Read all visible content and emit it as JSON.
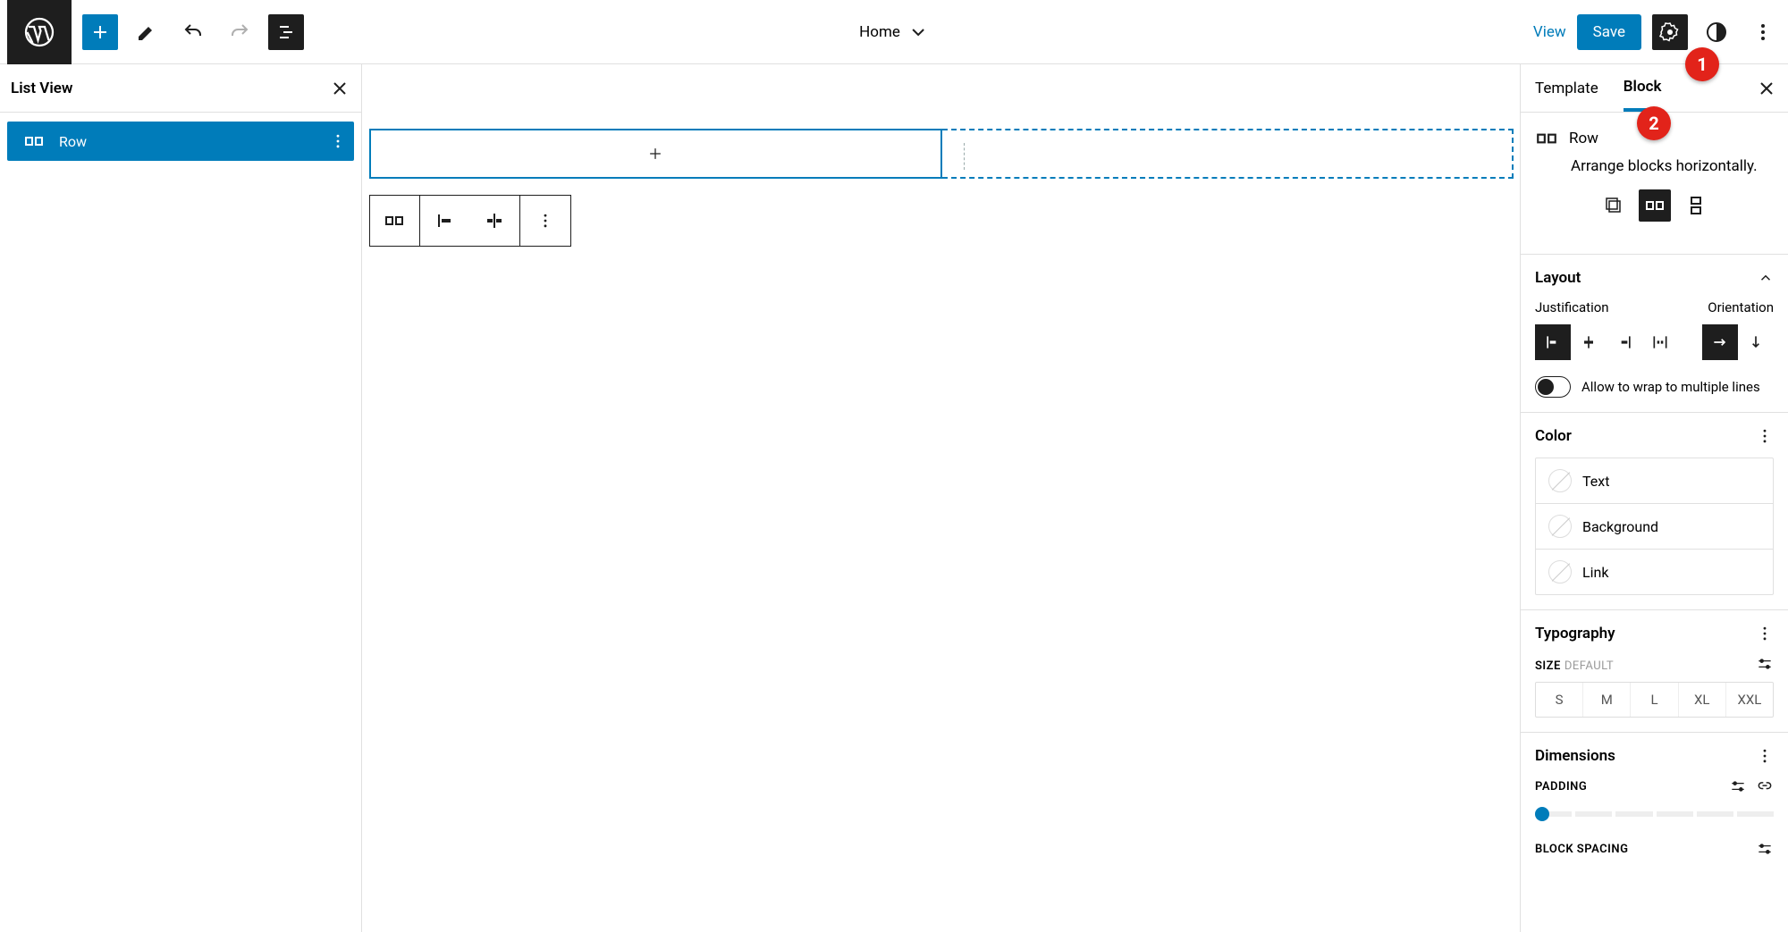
{
  "topbar": {
    "page_title": "Home",
    "view_label": "View",
    "save_label": "Save"
  },
  "listview": {
    "title": "List View",
    "item_label": "Row"
  },
  "settings": {
    "tabs": {
      "template": "Template",
      "block": "Block"
    },
    "block": {
      "name": "Row",
      "description": "Arrange blocks horizontally."
    },
    "layout": {
      "title": "Layout",
      "justification_label": "Justification",
      "orientation_label": "Orientation",
      "wrap_label": "Allow to wrap to multiple lines"
    },
    "color": {
      "title": "Color",
      "items": [
        "Text",
        "Background",
        "Link"
      ]
    },
    "typography": {
      "title": "Typography",
      "size_label": "SIZE",
      "size_default": "DEFAULT",
      "sizes": [
        "S",
        "M",
        "L",
        "XL",
        "XXL"
      ]
    },
    "dimensions": {
      "title": "Dimensions",
      "padding_label": "PADDING",
      "block_spacing_label": "BLOCK SPACING"
    }
  },
  "annotations": {
    "one": "1",
    "two": "2"
  },
  "colors": {
    "accent": "#007cba",
    "dark": "#1e1e1e",
    "callout": "#e2231a"
  }
}
